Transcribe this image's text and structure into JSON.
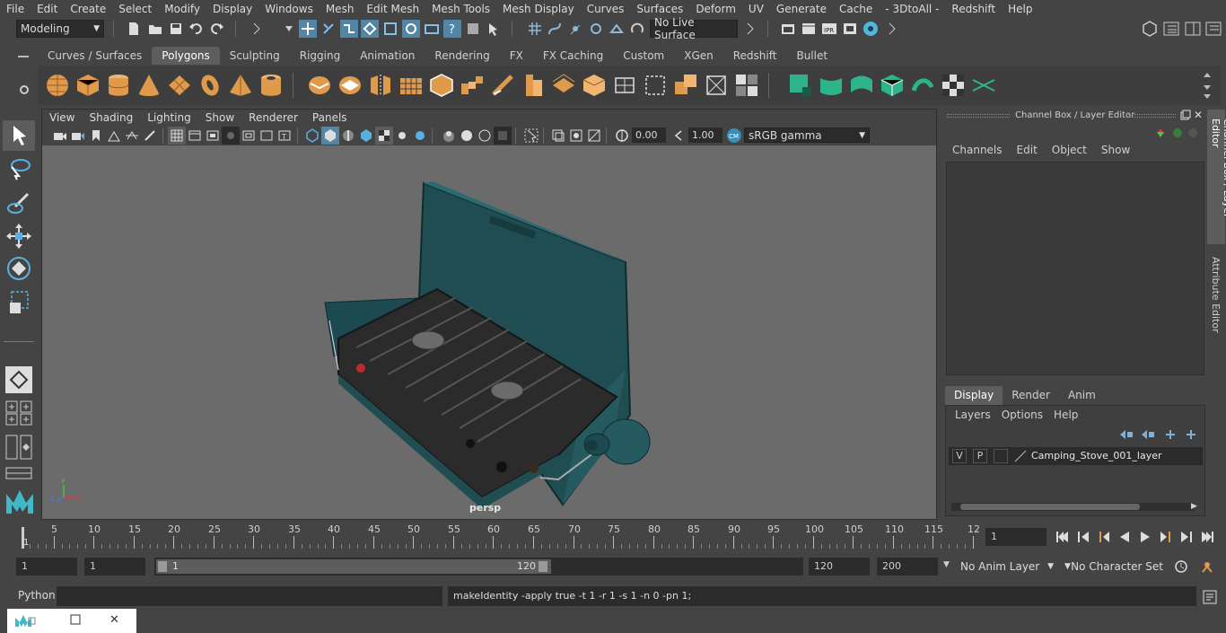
{
  "menus": [
    "File",
    "Edit",
    "Create",
    "Select",
    "Modify",
    "Display",
    "Windows",
    "Mesh",
    "Edit Mesh",
    "Mesh Tools",
    "Mesh Display",
    "Curves",
    "Surfaces",
    "Deform",
    "UV",
    "Generate",
    "Cache",
    "- 3DtoAll -",
    "Redshift",
    "Help"
  ],
  "status": {
    "mode": "Modeling",
    "live_surface": "No Live Surface"
  },
  "shelf": {
    "tabs": [
      "Curves / Surfaces",
      "Polygons",
      "Sculpting",
      "Rigging",
      "Animation",
      "Rendering",
      "FX",
      "FX Caching",
      "Custom",
      "XGen",
      "Redshift",
      "Bullet"
    ],
    "active_tab": "Polygons"
  },
  "viewport": {
    "menus": [
      "View",
      "Shading",
      "Lighting",
      "Show",
      "Renderer",
      "Panels"
    ],
    "exposure": "0.00",
    "gamma": "1.00",
    "color_space": "sRGB gamma",
    "camera": "persp",
    "axis": {
      "x": "x",
      "y": "y",
      "z": "z"
    }
  },
  "channelbox": {
    "title": "Channel Box / Layer Editor",
    "menus": [
      "Channels",
      "Edit",
      "Object",
      "Show"
    ],
    "layer_tabs": [
      "Display",
      "Render",
      "Anim"
    ],
    "active_layer_tab": "Display",
    "layer_menus": [
      "Layers",
      "Options",
      "Help"
    ],
    "layer": {
      "v": "V",
      "p": "P",
      "name": "Camping_Stove_001_layer"
    }
  },
  "side_tabs": [
    "Channel Box / Layer Editor",
    "Attribute Editor"
  ],
  "timeline": {
    "ticks": [
      "5",
      "10",
      "15",
      "20",
      "25",
      "30",
      "35",
      "40",
      "45",
      "50",
      "55",
      "60",
      "65",
      "70",
      "75",
      "80",
      "85",
      "90",
      "95",
      "100",
      "105",
      "110",
      "115",
      "12"
    ],
    "current_marker": "1",
    "current_frame": "1"
  },
  "range": {
    "start": "1",
    "playback_start": "1",
    "slider_start": "1",
    "slider_end": "120",
    "playback_end": "120",
    "end": "200",
    "anim_layer": "No Anim Layer",
    "char_set": "No Character Set"
  },
  "command": {
    "language": "Python",
    "result": "makeIdentity -apply true -t 1 -r 1 -s 1 -n 0 -pn 1;"
  },
  "colors": {
    "ui_bg": "#444444",
    "viewport_bg": "#6b6b6b",
    "shelf_icon": "#e09a4c",
    "shelf_icon_green": "#2fb38a",
    "accent_blue": "#5285a6",
    "stove_teal": "#1f4d52"
  }
}
